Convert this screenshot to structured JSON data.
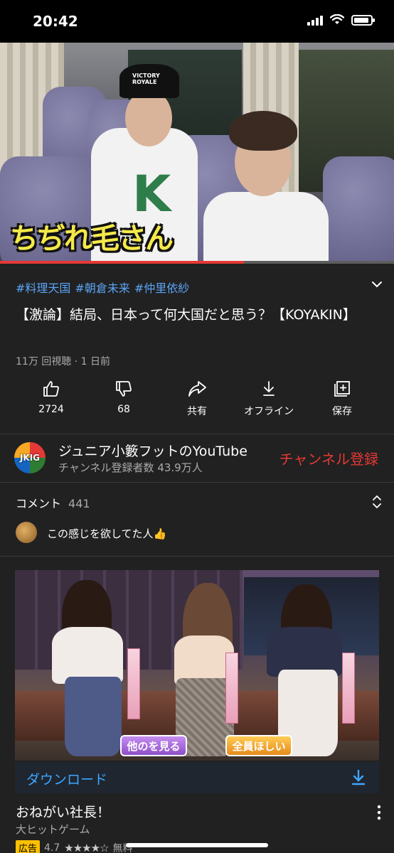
{
  "status": {
    "time": "20:42"
  },
  "video": {
    "caption": "ちぢれ毛さん",
    "progress": 0.62,
    "shirt_letter": "K",
    "cap_text": "VICTORY ROYALE"
  },
  "info": {
    "tags": [
      "#料理天国",
      "#朝倉未来",
      "#仲里依紗"
    ],
    "title": "【激論】結局、日本って何大国だと思う？【KOYAKIN】",
    "meta": "11万 回視聴 · 1 日前"
  },
  "actions": [
    {
      "label": "2724"
    },
    {
      "label": "68"
    },
    {
      "label": "共有"
    },
    {
      "label": "オフライン"
    },
    {
      "label": "保存"
    }
  ],
  "channel": {
    "avatar_text": "JKIG",
    "name": "ジュニア小籔フットのYouTube",
    "subscribers": "チャンネル登録者数 43.9万人",
    "subscribe_label": "チャンネル登録"
  },
  "comments": {
    "header": "コメント",
    "count": "441",
    "top_comment": "この感じを欲してた人👍"
  },
  "ad": {
    "button_left": "他のを見る",
    "button_right": "全員ほしい",
    "download_label": "ダウンロード",
    "title": "おねがい社長！",
    "subtitle": "大ヒットゲーム",
    "badge": "広告",
    "rating": "4.7",
    "stars": "★★★★☆",
    "price": "無料"
  },
  "colors": {
    "accent_red": "#e53935",
    "link_blue": "#3ea6ff",
    "background": "#212121"
  }
}
